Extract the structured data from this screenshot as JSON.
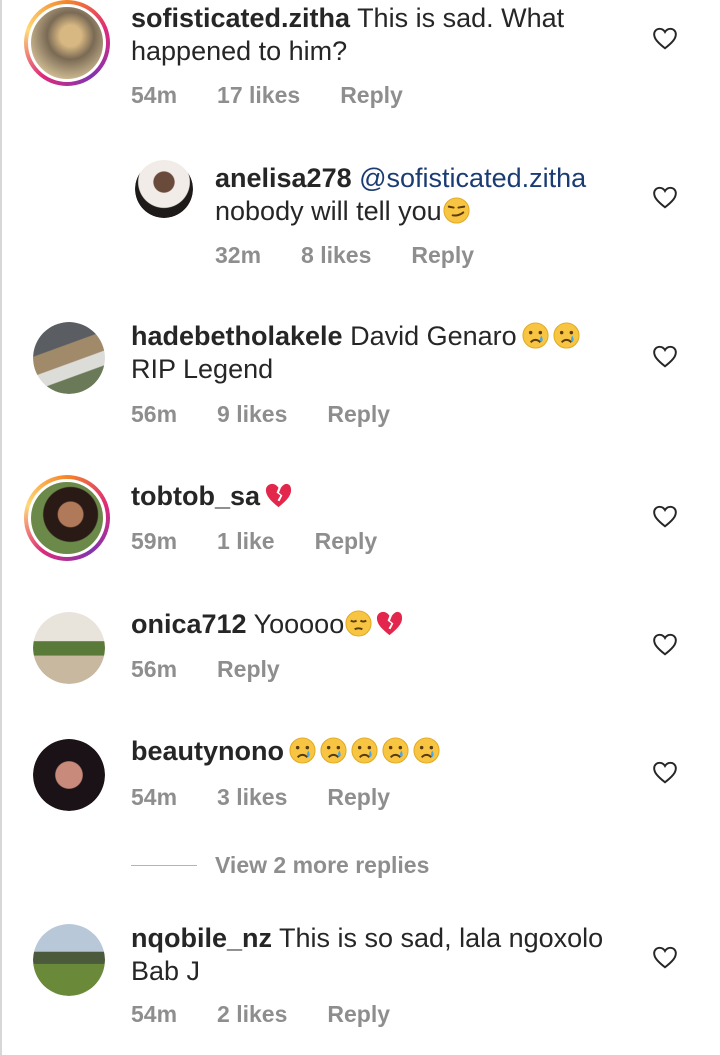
{
  "comments": [
    {
      "username": "sofisticated.zitha",
      "text_line1": "This is sad. What",
      "text_line2": "happened to him?",
      "time": "54m",
      "likes": "17 likes",
      "reply": "Reply",
      "story_ring": true,
      "avatar_colors": [
        "#7a6a55",
        "#d8b882"
      ]
    },
    {
      "username": "anelisa278",
      "mention": "@sofisticated.zitha",
      "text_line2": "nobody will tell you",
      "emoji": [
        "smirk"
      ],
      "time": "32m",
      "likes": "8 likes",
      "reply": "Reply",
      "story_ring": false,
      "avatar_colors": [
        "#e8e0dc",
        "#2a2220"
      ]
    },
    {
      "username": "hadebetholakele",
      "text_line1": "David Genaro",
      "emoji": [
        "cry",
        "cry"
      ],
      "text_line2": "RIP Legend",
      "time": "56m",
      "likes": "9 likes",
      "reply": "Reply",
      "story_ring": false,
      "avatar_colors": [
        "#6e6a64",
        "#3d4d5c"
      ]
    },
    {
      "username": "tobtob_sa",
      "emoji": [
        "broken-heart"
      ],
      "time": "59m",
      "likes": "1 like",
      "reply": "Reply",
      "story_ring": true,
      "avatar_colors": [
        "#6b8a4a",
        "#3a2a22"
      ]
    },
    {
      "username": "onica712",
      "text_line1": "Yooooo",
      "emoji": [
        "pensive",
        "broken-heart"
      ],
      "time": "56m",
      "reply": "Reply",
      "story_ring": false,
      "avatar_colors": [
        "#d8d0c4",
        "#4a6a3a"
      ]
    },
    {
      "username": "beautynono",
      "emoji": [
        "cry",
        "cry",
        "cry",
        "cry",
        "cry"
      ],
      "time": "54m",
      "likes": "3 likes",
      "reply": "Reply",
      "story_ring": false,
      "avatar_colors": [
        "#1a1216",
        "#c88a7a"
      ]
    },
    {
      "username": "nqobile_nz",
      "text_line1": "This is so sad, lala ngoxolo",
      "text_line2": "Bab J",
      "time": "54m",
      "likes": "2 likes",
      "reply": "Reply",
      "story_ring": false,
      "avatar_colors": [
        "#9cb0c8",
        "#4a6a30"
      ]
    }
  ],
  "view_more_replies": "View 2 more replies",
  "colors": {
    "text": "#262626",
    "meta": "#8e8e8e",
    "mention": "#1b3c73"
  }
}
